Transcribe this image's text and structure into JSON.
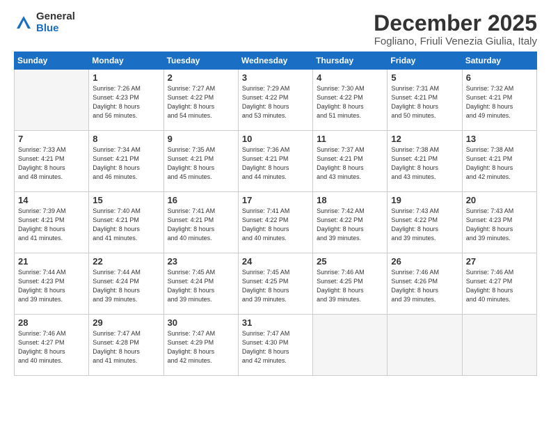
{
  "logo": {
    "general": "General",
    "blue": "Blue"
  },
  "title": "December 2025",
  "subtitle": "Fogliano, Friuli Venezia Giulia, Italy",
  "days_of_week": [
    "Sunday",
    "Monday",
    "Tuesday",
    "Wednesday",
    "Thursday",
    "Friday",
    "Saturday"
  ],
  "weeks": [
    [
      {
        "day": "",
        "info": ""
      },
      {
        "day": "1",
        "info": "Sunrise: 7:26 AM\nSunset: 4:23 PM\nDaylight: 8 hours\nand 56 minutes."
      },
      {
        "day": "2",
        "info": "Sunrise: 7:27 AM\nSunset: 4:22 PM\nDaylight: 8 hours\nand 54 minutes."
      },
      {
        "day": "3",
        "info": "Sunrise: 7:29 AM\nSunset: 4:22 PM\nDaylight: 8 hours\nand 53 minutes."
      },
      {
        "day": "4",
        "info": "Sunrise: 7:30 AM\nSunset: 4:22 PM\nDaylight: 8 hours\nand 51 minutes."
      },
      {
        "day": "5",
        "info": "Sunrise: 7:31 AM\nSunset: 4:21 PM\nDaylight: 8 hours\nand 50 minutes."
      },
      {
        "day": "6",
        "info": "Sunrise: 7:32 AM\nSunset: 4:21 PM\nDaylight: 8 hours\nand 49 minutes."
      }
    ],
    [
      {
        "day": "7",
        "info": "Sunrise: 7:33 AM\nSunset: 4:21 PM\nDaylight: 8 hours\nand 48 minutes."
      },
      {
        "day": "8",
        "info": "Sunrise: 7:34 AM\nSunset: 4:21 PM\nDaylight: 8 hours\nand 46 minutes."
      },
      {
        "day": "9",
        "info": "Sunrise: 7:35 AM\nSunset: 4:21 PM\nDaylight: 8 hours\nand 45 minutes."
      },
      {
        "day": "10",
        "info": "Sunrise: 7:36 AM\nSunset: 4:21 PM\nDaylight: 8 hours\nand 44 minutes."
      },
      {
        "day": "11",
        "info": "Sunrise: 7:37 AM\nSunset: 4:21 PM\nDaylight: 8 hours\nand 43 minutes."
      },
      {
        "day": "12",
        "info": "Sunrise: 7:38 AM\nSunset: 4:21 PM\nDaylight: 8 hours\nand 43 minutes."
      },
      {
        "day": "13",
        "info": "Sunrise: 7:38 AM\nSunset: 4:21 PM\nDaylight: 8 hours\nand 42 minutes."
      }
    ],
    [
      {
        "day": "14",
        "info": "Sunrise: 7:39 AM\nSunset: 4:21 PM\nDaylight: 8 hours\nand 41 minutes."
      },
      {
        "day": "15",
        "info": "Sunrise: 7:40 AM\nSunset: 4:21 PM\nDaylight: 8 hours\nand 41 minutes."
      },
      {
        "day": "16",
        "info": "Sunrise: 7:41 AM\nSunset: 4:21 PM\nDaylight: 8 hours\nand 40 minutes."
      },
      {
        "day": "17",
        "info": "Sunrise: 7:41 AM\nSunset: 4:22 PM\nDaylight: 8 hours\nand 40 minutes."
      },
      {
        "day": "18",
        "info": "Sunrise: 7:42 AM\nSunset: 4:22 PM\nDaylight: 8 hours\nand 39 minutes."
      },
      {
        "day": "19",
        "info": "Sunrise: 7:43 AM\nSunset: 4:22 PM\nDaylight: 8 hours\nand 39 minutes."
      },
      {
        "day": "20",
        "info": "Sunrise: 7:43 AM\nSunset: 4:23 PM\nDaylight: 8 hours\nand 39 minutes."
      }
    ],
    [
      {
        "day": "21",
        "info": "Sunrise: 7:44 AM\nSunset: 4:23 PM\nDaylight: 8 hours\nand 39 minutes."
      },
      {
        "day": "22",
        "info": "Sunrise: 7:44 AM\nSunset: 4:24 PM\nDaylight: 8 hours\nand 39 minutes."
      },
      {
        "day": "23",
        "info": "Sunrise: 7:45 AM\nSunset: 4:24 PM\nDaylight: 8 hours\nand 39 minutes."
      },
      {
        "day": "24",
        "info": "Sunrise: 7:45 AM\nSunset: 4:25 PM\nDaylight: 8 hours\nand 39 minutes."
      },
      {
        "day": "25",
        "info": "Sunrise: 7:46 AM\nSunset: 4:25 PM\nDaylight: 8 hours\nand 39 minutes."
      },
      {
        "day": "26",
        "info": "Sunrise: 7:46 AM\nSunset: 4:26 PM\nDaylight: 8 hours\nand 39 minutes."
      },
      {
        "day": "27",
        "info": "Sunrise: 7:46 AM\nSunset: 4:27 PM\nDaylight: 8 hours\nand 40 minutes."
      }
    ],
    [
      {
        "day": "28",
        "info": "Sunrise: 7:46 AM\nSunset: 4:27 PM\nDaylight: 8 hours\nand 40 minutes."
      },
      {
        "day": "29",
        "info": "Sunrise: 7:47 AM\nSunset: 4:28 PM\nDaylight: 8 hours\nand 41 minutes."
      },
      {
        "day": "30",
        "info": "Sunrise: 7:47 AM\nSunset: 4:29 PM\nDaylight: 8 hours\nand 42 minutes."
      },
      {
        "day": "31",
        "info": "Sunrise: 7:47 AM\nSunset: 4:30 PM\nDaylight: 8 hours\nand 42 minutes."
      },
      {
        "day": "",
        "info": ""
      },
      {
        "day": "",
        "info": ""
      },
      {
        "day": "",
        "info": ""
      }
    ]
  ]
}
